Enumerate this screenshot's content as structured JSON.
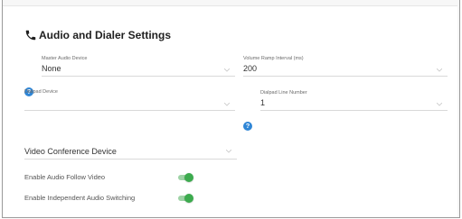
{
  "section": {
    "title": "Audio and Dialer Settings",
    "icon": "phone-icon"
  },
  "fields": {
    "master_audio_device": {
      "label": "Master Audio Device",
      "value": "None",
      "has_help": true
    },
    "volume_ramp_interval": {
      "label": "Volume Ramp Interval (ms)",
      "value": "200"
    },
    "dialpad_device": {
      "label": "Dialpad Device",
      "value": ""
    },
    "dialpad_line_number": {
      "label": "Dialpad Line Number",
      "value": "1",
      "has_help": true
    },
    "video_conference_device": {
      "label": "Video Conference Device"
    }
  },
  "toggles": [
    {
      "label": "Enable Audio Follow Video",
      "on": true
    },
    {
      "label": "Enable Independent Audio Switching",
      "on": true
    }
  ],
  "help_glyph": "?",
  "colors": {
    "accent_help": "#2f86d6",
    "toggle_on_thumb": "#3cab4e",
    "toggle_on_track": "#9ed3a6"
  }
}
